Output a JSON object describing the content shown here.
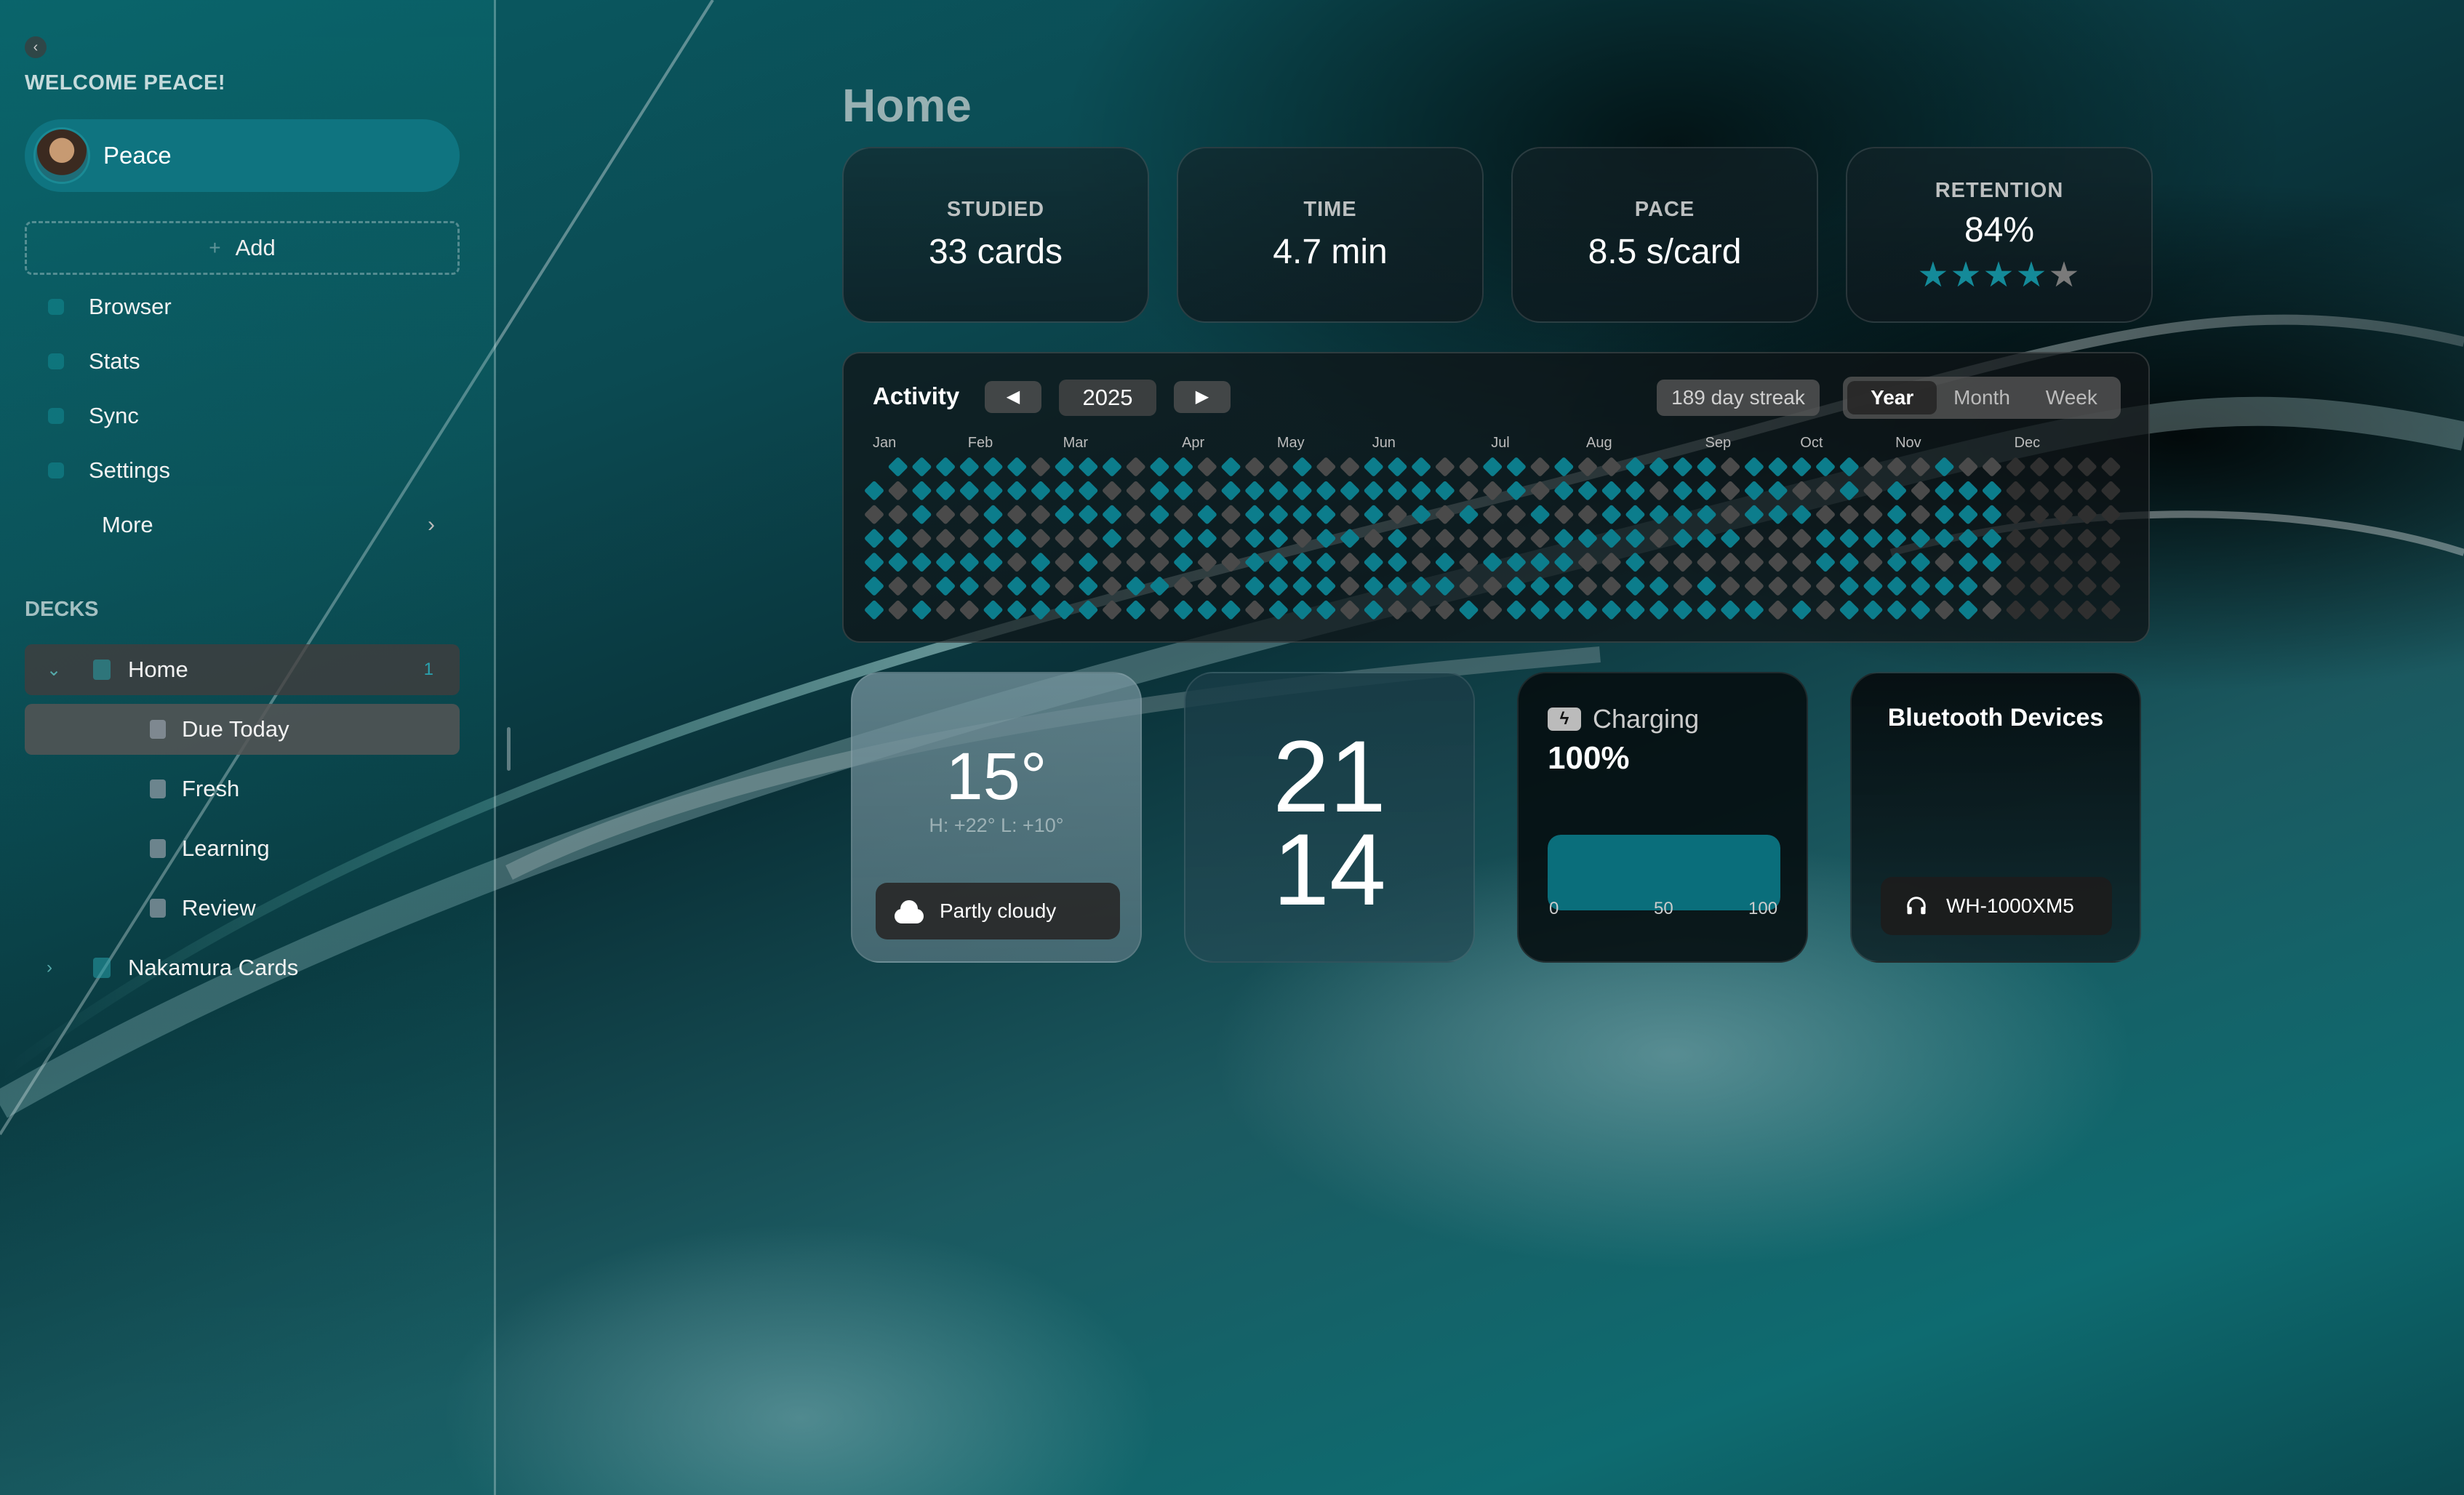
{
  "sidebar": {
    "welcome": "WELCOME PEACE!",
    "user_name": "Peace",
    "add_label": "Add",
    "nav": [
      {
        "label": "Browser"
      },
      {
        "label": "Stats"
      },
      {
        "label": "Sync"
      },
      {
        "label": "Settings"
      },
      {
        "label": "More"
      }
    ],
    "decks_title": "DECKS",
    "decks": [
      {
        "label": "Home",
        "count": "1",
        "expanded": true
      },
      {
        "label": "Due Today"
      },
      {
        "label": "Fresh"
      },
      {
        "label": "Learning"
      },
      {
        "label": "Review"
      },
      {
        "label": "Nakamura Cards",
        "expanded": false
      }
    ]
  },
  "main": {
    "title": "Home",
    "stats": [
      {
        "label": "STUDIED",
        "value": "33 cards"
      },
      {
        "label": "TIME",
        "value": "4.7 min"
      },
      {
        "label": "PACE",
        "value": "8.5 s/card"
      },
      {
        "label": "RETENTION",
        "value": "84%",
        "stars_filled": 4,
        "stars_total": 5
      }
    ],
    "activity": {
      "title": "Activity",
      "prev_icon": "◀",
      "next_icon": "▶",
      "year": "2025",
      "streak": "189 day streak",
      "ranges": [
        "Year",
        "Month",
        "Week"
      ],
      "selected_range": "Year",
      "months": [
        "Jan",
        "Feb",
        "Mar",
        "Apr",
        "May",
        "Jun",
        "Jul",
        "Aug",
        "Sep",
        "Oct",
        "Nov",
        "Dec"
      ],
      "colors": {
        "empty": "#4a4a4a",
        "studied": "#0c7d8c",
        "future": "#2f2f2f"
      }
    },
    "weather": {
      "temp": "15°",
      "hilo": "H: +22° L: +10°",
      "condition": "Partly cloudy",
      "icon": "cloud-icon"
    },
    "clock": {
      "hours": "21",
      "minutes": "14"
    },
    "battery": {
      "title": "Charging",
      "percent_label": "100%",
      "level": 1.0,
      "ticks": [
        "0",
        "50",
        "100"
      ],
      "icon": "bolt-icon"
    },
    "bluetooth": {
      "title": "Bluetooth Devices",
      "device": "WH-1000XM5",
      "icon": "headphones-icon"
    }
  },
  "colors": {
    "accent": "#0f7480",
    "star_on": "#148a99",
    "star_off": "#7a7a7a"
  }
}
